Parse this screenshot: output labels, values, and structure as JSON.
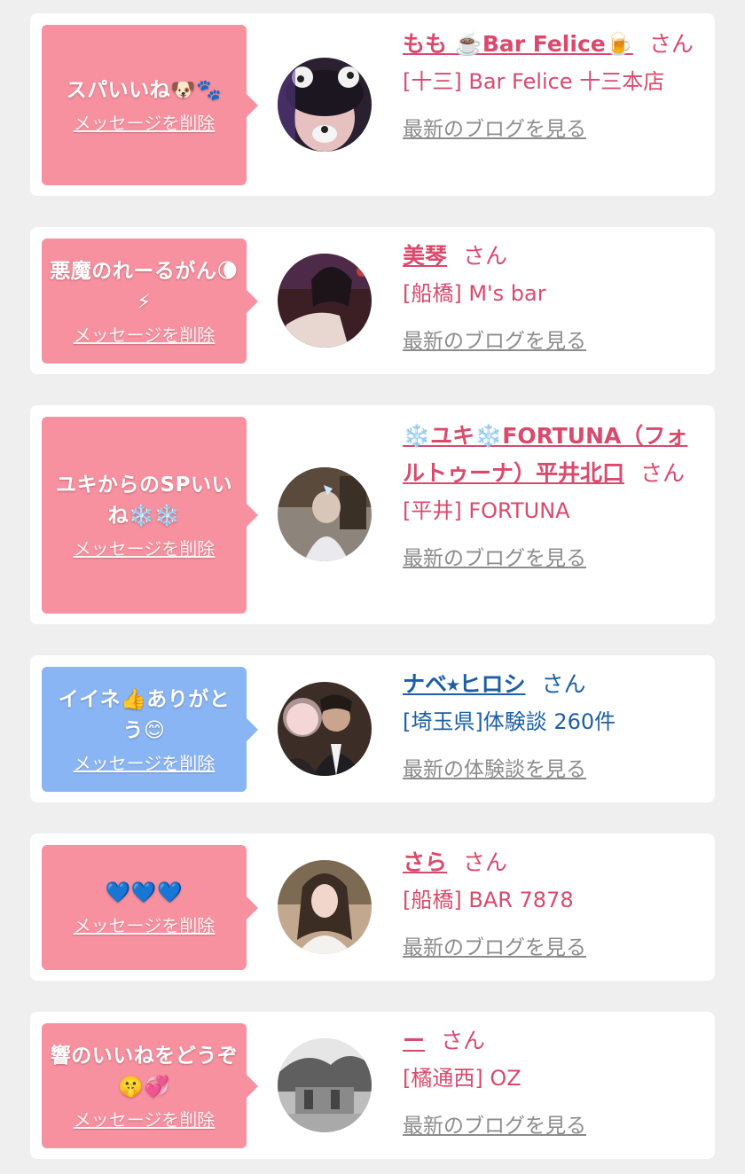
{
  "suffix": "さん",
  "delete_label": "メッセージを削除",
  "colors": {
    "pink_bubble": "#f7909f",
    "blue_bubble": "#8ab5f4",
    "pink_text": "#d94a6d",
    "blue_text": "#1d5ea6"
  },
  "items": [
    {
      "message": "スパいいね🐶🐾",
      "name": "もも ☕️Bar Felice🍺",
      "shop": "[十三] Bar Felice 十三本店",
      "link": "最新のブログを見る",
      "bubble_color": "pink"
    },
    {
      "message": "悪魔のれーるがん🌘⚡",
      "name": "美琴",
      "shop": "[船橋] M's bar",
      "link": "最新のブログを見る",
      "bubble_color": "pink"
    },
    {
      "message": "ユキからのSPいいね❄️❄️",
      "name": "❄️ユキ❄️FORTUNA（フォルトゥーナ）平井北口",
      "shop": "[平井] FORTUNA",
      "link": "最新のブログを見る",
      "bubble_color": "pink"
    },
    {
      "message": "イイネ👍ありがとう😊",
      "name": "ナベ⭑ヒロシ",
      "shop": "[埼玉県]体験談 260件",
      "link": "最新の体験談を見る",
      "bubble_color": "blue"
    },
    {
      "message": "💙💙💙",
      "name": "さら",
      "shop": "[船橋] BAR 7878",
      "link": "最新のブログを見る",
      "bubble_color": "pink"
    },
    {
      "message": "響のいいねをどうぞ🤫💞",
      "name": "ー",
      "shop": "[橘通西] OZ",
      "link": "最新のブログを見る",
      "bubble_color": "pink"
    }
  ]
}
